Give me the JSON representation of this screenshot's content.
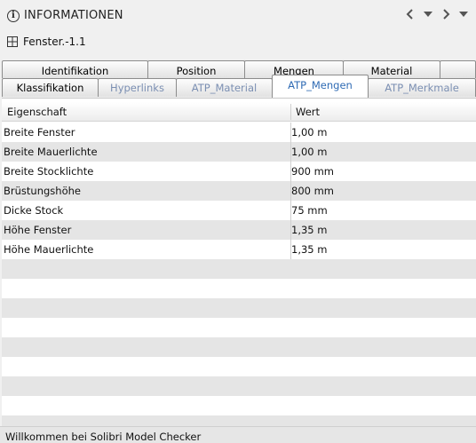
{
  "header": {
    "title": "INFORMATIONEN",
    "icons": [
      "info-icon",
      "prev-icon",
      "dropdown-icon",
      "next-icon",
      "menu-icon"
    ]
  },
  "object": {
    "name": "Fenster.-1.1",
    "icon": "window-icon"
  },
  "tabs": {
    "row1": [
      "Identifikation",
      "Position",
      "Mengen",
      "Material"
    ],
    "row2": [
      "Klassifikation",
      "Hyperlinks",
      "ATP_Material",
      "ATP_Mengen",
      "ATP_Merkmale"
    ],
    "active": "ATP_Mengen"
  },
  "table": {
    "columns": [
      "Eigenschaft",
      "Wert"
    ],
    "rows": [
      [
        "Breite Fenster",
        "1,00 m"
      ],
      [
        "Breite Mauerlichte",
        "1,00 m"
      ],
      [
        "Breite Stocklichte",
        "900 mm"
      ],
      [
        "Brüstungshöhe",
        "800 mm"
      ],
      [
        "Dicke Stock",
        "75 mm"
      ],
      [
        "Höhe Fenster",
        "1,35 m"
      ],
      [
        "Höhe Mauerlichte",
        "1,35 m"
      ]
    ]
  },
  "status": {
    "text": "Willkommen bei Solibri Model Checker"
  }
}
